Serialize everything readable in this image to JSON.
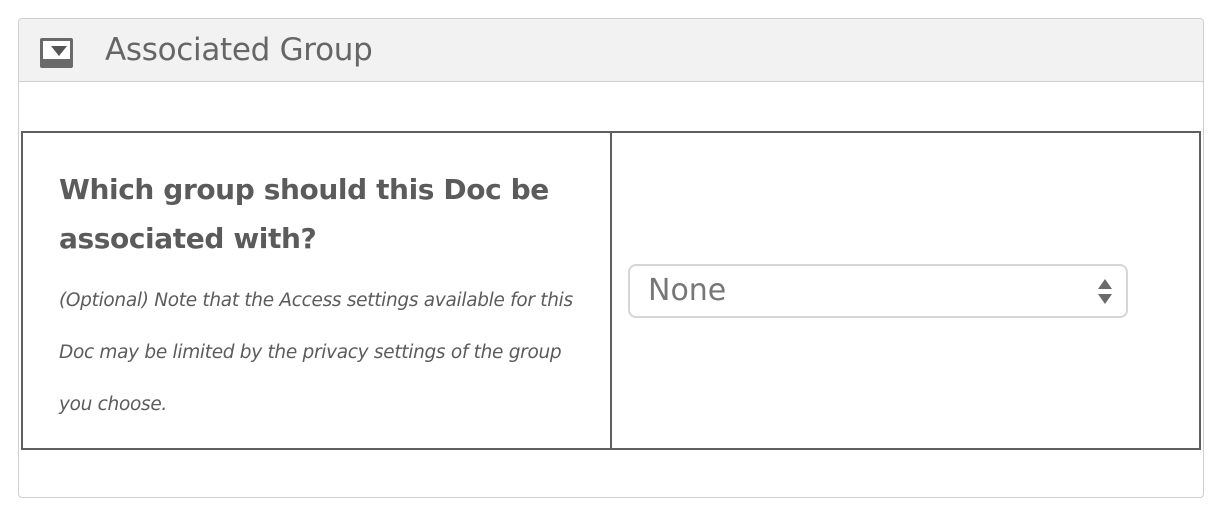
{
  "panel": {
    "title": "Associated Group",
    "toggle_icon": "triangle-down-icon"
  },
  "form": {
    "question": "Which group should this Doc be associated with?",
    "note": "(Optional) Note that the Access settings available for this Doc may be limited by the privacy settings of the group you choose.",
    "group_select": {
      "selected": "None",
      "arrows_icon": "select-arrows-icon"
    }
  },
  "colors": {
    "header_bg": "#f2f2f2",
    "border": "#5f5f5f",
    "text": "#5b5b5b"
  }
}
